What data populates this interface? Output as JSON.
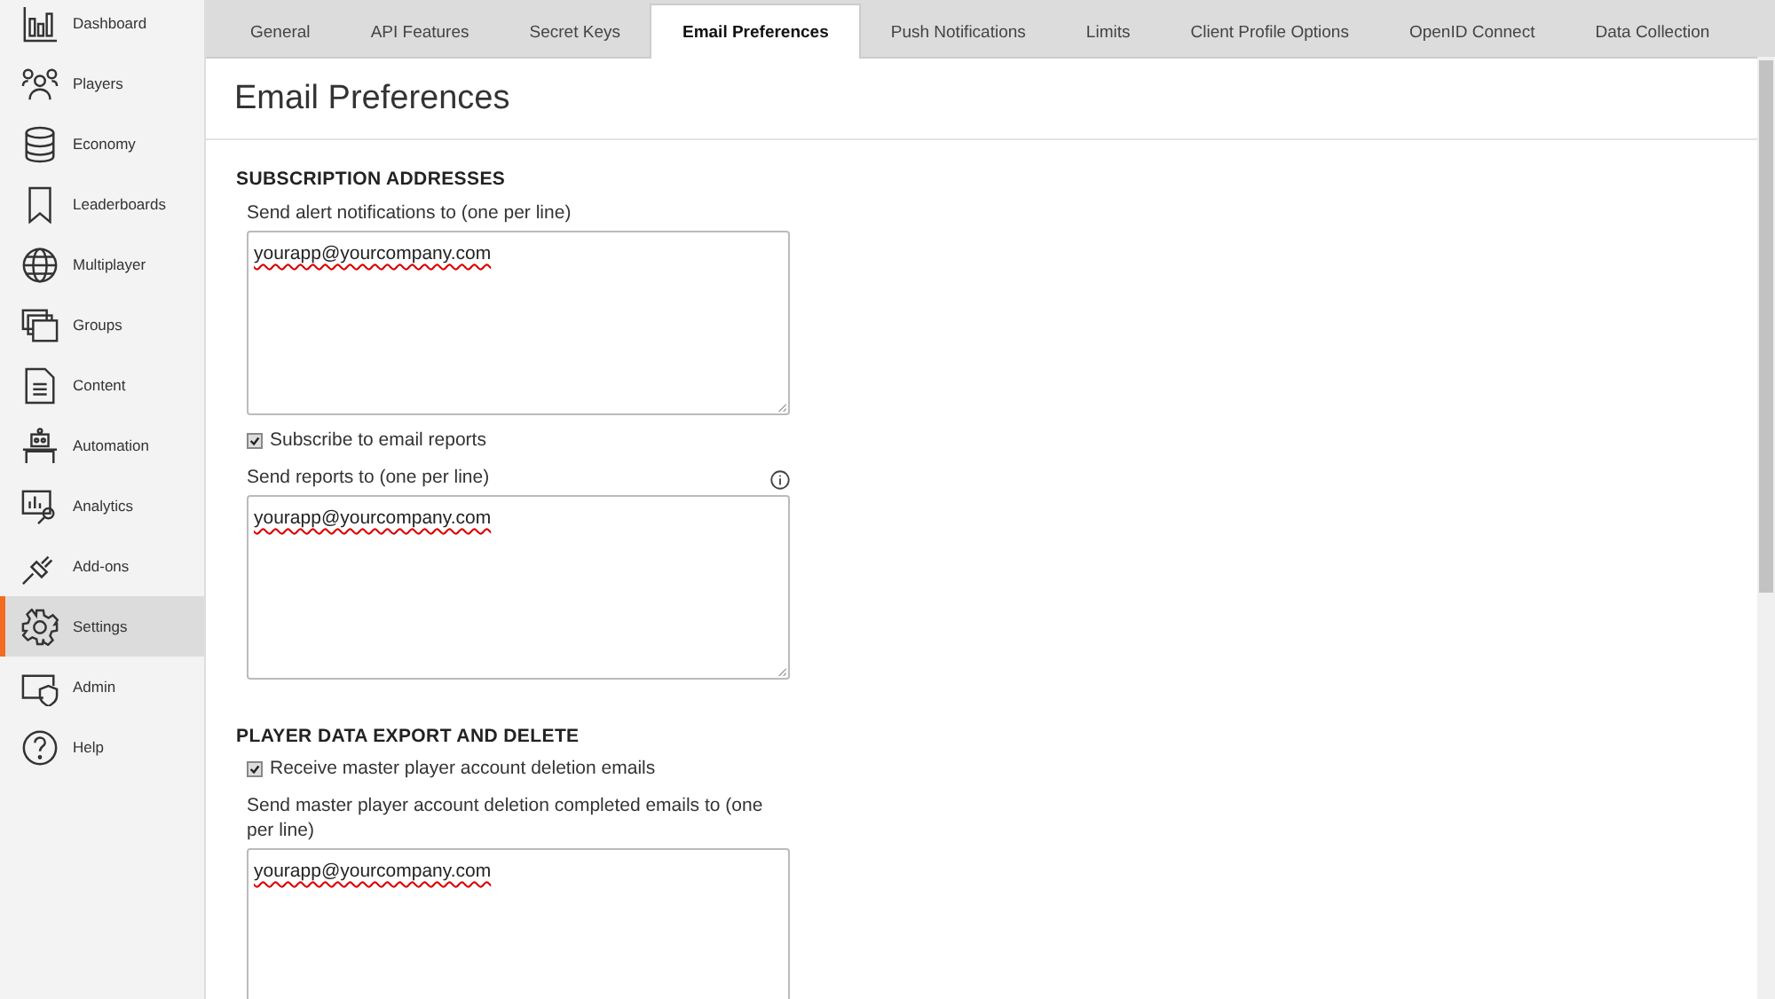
{
  "sidebar": {
    "items": [
      {
        "label": "Dashboard",
        "selected": false
      },
      {
        "label": "Players",
        "selected": false
      },
      {
        "label": "Economy",
        "selected": false
      },
      {
        "label": "Leaderboards",
        "selected": false
      },
      {
        "label": "Multiplayer",
        "selected": false
      },
      {
        "label": "Groups",
        "selected": false
      },
      {
        "label": "Content",
        "selected": false
      },
      {
        "label": "Automation",
        "selected": false
      },
      {
        "label": "Analytics",
        "selected": false
      },
      {
        "label": "Add-ons",
        "selected": false
      },
      {
        "label": "Settings",
        "selected": true
      },
      {
        "label": "Admin",
        "selected": false
      },
      {
        "label": "Help",
        "selected": false
      }
    ]
  },
  "tabs": [
    {
      "label": "General",
      "selected": false
    },
    {
      "label": "API Features",
      "selected": false
    },
    {
      "label": "Secret Keys",
      "selected": false
    },
    {
      "label": "Email Preferences",
      "selected": true
    },
    {
      "label": "Push Notifications",
      "selected": false
    },
    {
      "label": "Limits",
      "selected": false
    },
    {
      "label": "Client Profile Options",
      "selected": false
    },
    {
      "label": "OpenID Connect",
      "selected": false
    },
    {
      "label": "Data Collection",
      "selected": false
    }
  ],
  "page_title": "Email Preferences",
  "sections": [
    {
      "title": "SUBSCRIPTION ADDRESSES",
      "items": [
        {
          "kind": "textarea",
          "label": "Send alert notifications to (one per line)",
          "value": "yourapp@yourcompany.com",
          "info": false
        },
        {
          "kind": "checkbox",
          "label": "Subscribe to email reports",
          "checked": true
        },
        {
          "kind": "textarea",
          "label": "Send reports to (one per line)",
          "value": "yourapp@yourcompany.com",
          "info": true
        }
      ]
    },
    {
      "title": "PLAYER DATA EXPORT AND DELETE",
      "items": [
        {
          "kind": "checkbox",
          "label": "Receive master player account deletion emails",
          "checked": true
        },
        {
          "kind": "textarea",
          "label": "Send master player account deletion completed emails to (one per line)",
          "value": "yourapp@yourcompany.com",
          "info": false
        }
      ]
    }
  ]
}
